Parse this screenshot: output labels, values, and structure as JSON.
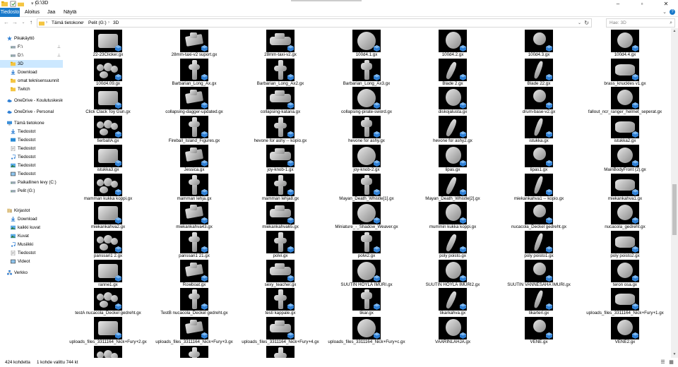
{
  "window": {
    "title": "G:\\3D",
    "controls": [
      "minimize",
      "maximize",
      "close"
    ]
  },
  "ribbon": {
    "tabs": [
      "Tiedosto",
      "Aloitus",
      "Jaa",
      "Näytä"
    ]
  },
  "addressbar": {
    "breadcrumb": [
      "Tämä tietokone",
      "Pelit (G:)",
      "3D"
    ],
    "search_placeholder": "Hae: 3D"
  },
  "nav": {
    "items": [
      {
        "label": "Pikakäyttö",
        "icon": "star-icon",
        "level": 0
      },
      {
        "label": "F:\\",
        "icon": "drive-icon",
        "level": 1,
        "pinned": true
      },
      {
        "label": "D:\\",
        "icon": "drive-icon",
        "level": 1,
        "pinned": true
      },
      {
        "label": "3D",
        "icon": "folder-icon",
        "level": 1,
        "selected": true
      },
      {
        "label": "Download",
        "icon": "download-icon",
        "level": 1
      },
      {
        "label": "omat teknisensuunnit",
        "icon": "folder-icon",
        "level": 1
      },
      {
        "label": "Twitch",
        "icon": "folder-icon",
        "level": 1
      },
      {
        "label": "OneDrive - Koulutuskeskus",
        "icon": "cloud-icon",
        "level": 0
      },
      {
        "label": "OneDrive - Personal",
        "icon": "cloud-icon",
        "level": 0
      },
      {
        "label": "Tämä tietokone",
        "icon": "computer-icon",
        "level": 0
      },
      {
        "label": "Tiedostot",
        "icon": "download-icon",
        "level": 1
      },
      {
        "label": "Tiedostot",
        "icon": "desktop-icon",
        "level": 1
      },
      {
        "label": "Tiedostot",
        "icon": "document-icon",
        "level": 1
      },
      {
        "label": "Tiedostot",
        "icon": "music-icon",
        "level": 1
      },
      {
        "label": "Tiedostot",
        "icon": "picture-icon",
        "level": 1
      },
      {
        "label": "Tiedostot",
        "icon": "video-icon",
        "level": 1
      },
      {
        "label": "Paikallinen levy (C:)",
        "icon": "drive-icon",
        "level": 1
      },
      {
        "label": "Pelit (G:)",
        "icon": "drive-icon",
        "level": 1
      },
      {
        "label": "Kirjastot",
        "icon": "library-icon",
        "level": 0
      },
      {
        "label": "Download",
        "icon": "download-icon",
        "level": 1
      },
      {
        "label": "kaikki kuvat",
        "icon": "picture-icon",
        "level": 1
      },
      {
        "label": "Kuvat",
        "icon": "picture-icon",
        "level": 1
      },
      {
        "label": "Musiikki",
        "icon": "music-icon",
        "level": 1
      },
      {
        "label": "Tiedostot",
        "icon": "document-icon",
        "level": 1
      },
      {
        "label": "Videot",
        "icon": "video-icon",
        "level": 1
      },
      {
        "label": "Verkko",
        "icon": "network-icon",
        "level": 0
      }
    ]
  },
  "files": [
    "22-23Clicker.gx",
    "28mm-taxi-v2 suport.gx",
    "28mm-taxi-v2.gx",
    "100d4.1.gx",
    "100d4.2.gx",
    "100d4.3.gx",
    "100d4.4.gx",
    "100d4.09.gx",
    "Barbarian_Long_Ax.gx",
    "Barbarian_Long_Ax2.gx",
    "Barbarian_Long_Ax3.gx",
    "Blade 2.gx",
    "Blade 22.gx",
    "brass_knuckles v1.gx",
    "Click Clack Toy Gun.gx",
    "collapsing-dagger-updated.gx",
    "collapsing-katana.gx",
    "collapsing-pirate-sword.gx",
    "diskojalusta.gx",
    "drum-base-v2.gx",
    "fallout_ncr_ranger_helmet_seperat.gx",
    "fierbalIA.gx",
    "Fireball_Island_Figures.gx",
    "hevone for ashy -- kopio.gx",
    "hevone for ashy.gx",
    "hevone for ashy2.gx",
    "istukka.gx",
    "istukka2.gx",
    "istukka3.gx",
    "Jessica.gx",
    "joy-knob-1.gx",
    "joy-knob-2.gx",
    "lipas.gx",
    "lipas1.gx",
    "MainBodyFront (2).gx",
    "mamman kukka koppi.gx",
    "mamman lehja.gx",
    "mamman lehja8.gx",
    "Mayan_Death_Whistle[1].gx",
    "Mayan_Death_Whistle[2].gx",
    "miekankahva1 -- kopio.gx",
    "miekankahva1.gx",
    "miekankahva2.gx",
    "miekankahva43.gx",
    "miekankahva65.gx",
    "Miniature_-_Shadow_Weaver.gx",
    "mummin kukka koppi.gx",
    "nucacola_Deckel gedreht.gx",
    "nucacola_gedreht.gx",
    "panssari1 2.gx",
    "panssari1 21.gx",
    "polvi.gx",
    "polvi2.gx",
    "poly poisto.gx",
    "poly poisto1.gx",
    "poly poisto2.gx",
    "ranne1.gx",
    "Rowboat.gx",
    "sexy_teacher.gx",
    "SUUTIN HÖYLÄ IMURI.gx",
    "SUUTIN HÖYLÄ IMURI2.gx",
    "SUUTIN VANNESAHA IMURI.gx",
    "teron osa.gx",
    "testA nucacola_Deckel gedreht.gx",
    "TestB nucacola_Deckel gedreht.gx",
    "testi kappale.gx",
    "tikar.gx",
    "tikarkahva.gx",
    "tikarteri.gx",
    "uploads_files_3311164_Nick+Fury+1.gx",
    "uploads_files_3311164_Nick+Fury+2.gx",
    "uploads_files_3311164_Nick+Fury+3.gx",
    "uploads_files_3311164_Nick+Fury+4.gx",
    "uploads_files_3311164_Nick+Fury+c.gx",
    "VAARINLAHJA.gx",
    "VENE.gx",
    "VENE2.gx",
    "",
    "",
    ""
  ],
  "status": {
    "count": "424 kohdetta",
    "selection": "1 kohde valittu 744 kt"
  },
  "colors": {
    "accent": "#1979ca",
    "selected_bg": "#cce8ff",
    "thumb_bg": "#000000",
    "badge": "#2f7fd4"
  }
}
